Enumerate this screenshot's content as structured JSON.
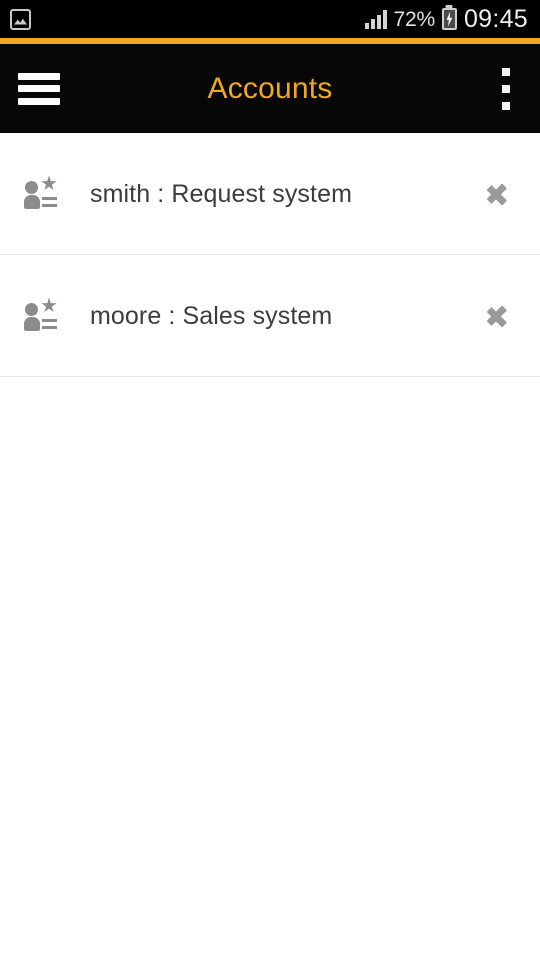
{
  "status_bar": {
    "notification_icon": "image-icon",
    "signal_icon": "signal-bars-icon",
    "battery_percent": "72%",
    "battery_icon": "battery-charging-icon",
    "time": "09:45"
  },
  "app_bar": {
    "menu_icon": "hamburger-menu-icon",
    "title": "Accounts",
    "overflow_icon": "overflow-menu-icon",
    "accent_color": "#f0a81e",
    "background_color": "#000000"
  },
  "list": {
    "rows": [
      {
        "icon": "contact-star-icon",
        "label": "smith : Request system",
        "chevron": "chevron-right-icon"
      },
      {
        "icon": "contact-star-icon",
        "label": "moore : Sales system",
        "chevron": "chevron-right-icon"
      }
    ]
  }
}
